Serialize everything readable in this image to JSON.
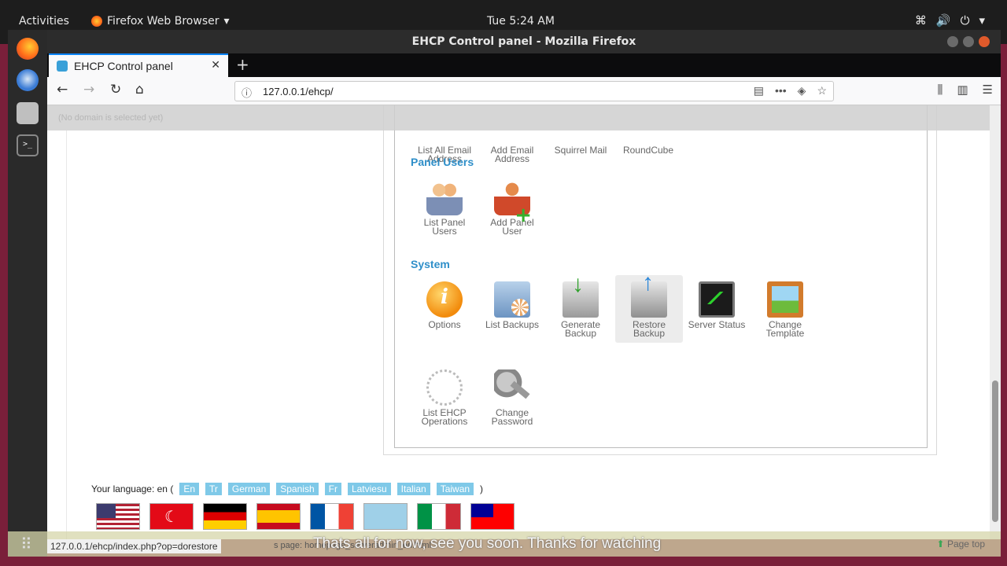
{
  "topbar": {
    "activities": "Activities",
    "app_name": "Firefox Web Browser",
    "clock": "Tue  5:24 AM"
  },
  "window": {
    "title": "EHCP Control panel - Mozilla Firefox"
  },
  "tab": {
    "title": "EHCP Control panel"
  },
  "navbar": {
    "url": "127.0.0.1/ehcp/"
  },
  "page": {
    "no_domain": "(No domain is selected yet)",
    "top_items": [
      {
        "label1": "List All Email",
        "label2": "Address"
      },
      {
        "label1": "Add Email",
        "label2": "Address"
      },
      {
        "label1": "Squirrel Mail",
        "label2": ""
      },
      {
        "label1": "RoundCube",
        "label2": ""
      }
    ],
    "panel_users": {
      "title": "Panel Users",
      "items": [
        {
          "label1": "List Panel",
          "label2": "Users",
          "icon": "users-icon"
        },
        {
          "label1": "Add Panel",
          "label2": "User",
          "icon": "add-user-icon"
        }
      ]
    },
    "system": {
      "title": "System",
      "items": [
        {
          "label1": "Options",
          "label2": "",
          "icon": "options-icon"
        },
        {
          "label1": "List Backups",
          "label2": "",
          "icon": "backups-icon"
        },
        {
          "label1": "Generate",
          "label2": "Backup",
          "icon": "generate-backup-icon"
        },
        {
          "label1": "Restore",
          "label2": "Backup",
          "icon": "restore-backup-icon"
        },
        {
          "label1": "Server Status",
          "label2": "",
          "icon": "server-status-icon"
        },
        {
          "label1": "Change",
          "label2": "Template",
          "icon": "template-icon"
        },
        {
          "label1": "List EHCP",
          "label2": "Operations",
          "icon": "operations-icon"
        },
        {
          "label1": "Change",
          "label2": "Password",
          "icon": "password-icon"
        }
      ]
    },
    "language": {
      "prefix": "Your language: en (",
      "suffix": ")",
      "links": [
        "En",
        "Tr",
        "German",
        "Spanish",
        "Fr",
        "Latviesu",
        "Italian",
        "Taiwan"
      ]
    }
  },
  "status": {
    "url": "127.0.0.1/ehcp/index.php?op=dorestore",
    "hint": "s page: homepage_serveradmin_en.html",
    "subtitle": "Thats all for now, see you soon. Thanks for watching",
    "page_top": "Page top"
  }
}
